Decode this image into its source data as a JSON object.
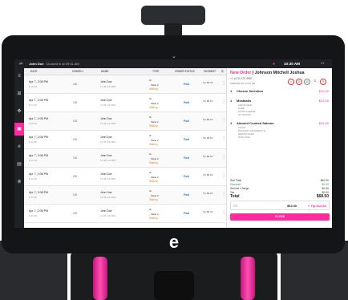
{
  "topbar": {
    "user": "John Doe",
    "clocked": "Clocked in at 09:31 AM",
    "time": "10:30 AM"
  },
  "columns": [
    "DATE",
    "ORDER #",
    "NAME",
    "TYPE",
    "ORDER STATUS",
    "PAYMENT"
  ],
  "orders": [
    {
      "date": "Apr 7, 2:08 PM",
      "sub": "$ 12.00",
      "num": "100",
      "name": "John Doe",
      "time": "11:48 (12:48P)",
      "type": "Table 2",
      "status": "Waiting",
      "paid": "Paid",
      "pay": "Tip $8.00"
    },
    {
      "date": "Apr 7, 2:08 PM",
      "sub": "$ 12.00",
      "num": "100",
      "name": "John Doe",
      "time": "11:48 (12:48P)",
      "type": "Table 2",
      "status": "Waiting",
      "paid": "Paid",
      "pay": "Tip $8.00"
    },
    {
      "date": "Apr 7, 2:08 PM",
      "sub": "$ 12.00",
      "num": "100",
      "name": "John Doe",
      "time": "11:48 (12:48P)",
      "type": "Table 2",
      "status": "Waiting",
      "paid": "Paid",
      "pay": "Tip $8.00"
    },
    {
      "date": "Apr 7, 2:08 PM",
      "sub": "$ 12.00",
      "num": "100",
      "name": "John Doe",
      "time": "11:48 (12:48P)",
      "type": "Table 2",
      "status": "Waiting",
      "paid": "Paid",
      "pay": "Tip $8.00"
    },
    {
      "date": "Apr 7, 2:08 PM",
      "sub": "$ 12.00",
      "num": "100",
      "name": "John Doe",
      "time": "11:48 (12:48P)",
      "type": "Table 2",
      "status": "Waiting",
      "paid": "Paid",
      "pay": "Tip $8.00"
    },
    {
      "date": "Apr 7, 2:08 PM",
      "sub": "$ 12.00",
      "num": "100",
      "name": "John Doe",
      "time": "11:48 (12:48P)",
      "type": "Table 2",
      "status": "Waiting",
      "paid": "Paid",
      "pay": "Tip $8.00"
    },
    {
      "date": "Apr 7, 2:08 PM",
      "sub": "$ 12.00",
      "num": "100",
      "name": "John Doe",
      "time": "11:48 (12:48P)",
      "type": "Table 2",
      "status": "Waiting",
      "paid": "Paid",
      "pay": "Tip $8.00"
    },
    {
      "date": "Apr 7, 2:08 PM",
      "sub": "$ 12.00",
      "num": "100",
      "name": "John Doe",
      "time": "11:48 (12:48P)",
      "type": "Table 2",
      "status": "Waiting",
      "paid": "Paid",
      "pay": "Tip $8.00"
    }
  ],
  "detail": {
    "title_prefix": "New Order",
    "title_name": "| Johnson Mitchell Joshua",
    "phone": "+1 (470) 123 4567",
    "arrived": "ARRIVED AT 03:00 PM",
    "items": [
      {
        "qty": "1",
        "name": "Cheese Selection",
        "price": "$12.00",
        "mods": []
      },
      {
        "qty": "1",
        "name": "Meatballs",
        "price": "$23.00",
        "mods": [
          "LARGE MEAL",
          "RARE",
          "EXTRA CHEESE",
          "NO ONIONS"
        ]
      },
      {
        "qty": "1",
        "name": "Almond Crusted Salmon",
        "price": "$21.00",
        "mods": [
          "SALAD",
          "BALSAMIC VINAIGRETTE",
          "MEDIUM RARE",
          "WITH RICE"
        ]
      }
    ],
    "subtotal_label": "Sub Total",
    "subtotal": "$62.00",
    "discount_label": "Discount",
    "discount": "$0.00",
    "service_label": "Service Charge",
    "service": "$0.50",
    "tax_label": "Tax",
    "tax": "$0.00",
    "total_label": "Total",
    "total": "$68.50",
    "pay_amount": "$62.00",
    "pay_tip": "+ Tip $12.84",
    "close_label": "CLOSE"
  }
}
